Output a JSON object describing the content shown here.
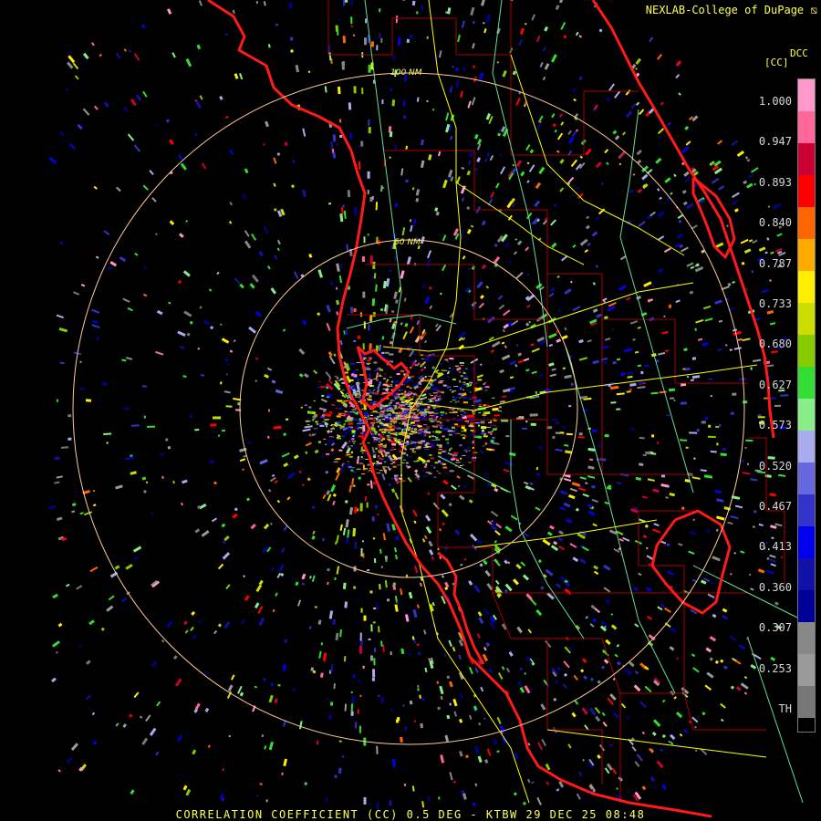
{
  "header": {
    "credit": "NEXLAB-College of DuPage ⧅"
  },
  "legend": {
    "product_code": "DCC",
    "unit": "[CC]",
    "ticks": [
      "1.000",
      "0.947",
      "0.893",
      "0.840",
      "0.787",
      "0.733",
      "0.680",
      "0.627",
      "0.573",
      "0.520",
      "0.467",
      "0.413",
      "0.360",
      "0.307",
      "0.253",
      "TH"
    ],
    "colors": [
      "#ff99cc",
      "#ff6699",
      "#cc0033",
      "#ff0000",
      "#ff6600",
      "#ffaa00",
      "#ffee00",
      "#ccdd00",
      "#88cc00",
      "#33dd33",
      "#88ee88",
      "#aaaaee",
      "#6666dd",
      "#3333cc",
      "#0000ee",
      "#1111aa",
      "#000099",
      "#888888",
      "#9a9a9a",
      "#777777"
    ]
  },
  "map": {
    "range_rings": [
      "50 NM",
      "100 NM"
    ],
    "colors": {
      "coast": "#ff1a1a",
      "county": "#a80000",
      "road": "#ffff00",
      "minor_road": "#66dd99",
      "ring": "#ffcc99"
    }
  },
  "footer": {
    "caption": "CORRELATION COEFFICIENT (CC) 0.5 DEG - KTBW 29 DEC 25 08:48"
  }
}
